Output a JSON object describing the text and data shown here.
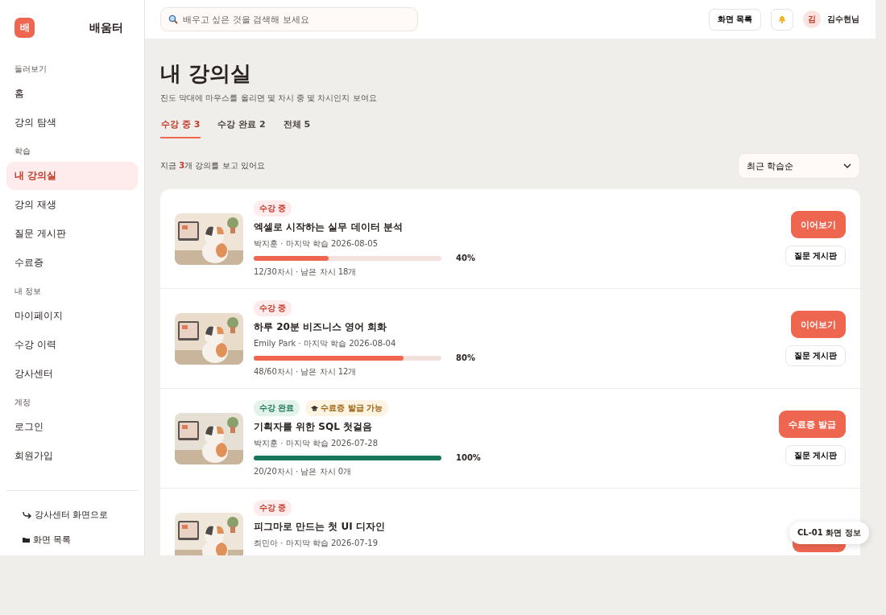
{
  "sidebar": {
    "logo": {
      "mark": "배",
      "name": "배움터"
    },
    "sections": [
      {
        "title": "둘러보기",
        "items": [
          {
            "label": "홈",
            "selected": false
          },
          {
            "label": "강의 탐색",
            "selected": false
          }
        ]
      },
      {
        "title": "학습",
        "items": [
          {
            "label": "내 강의실",
            "selected": true
          },
          {
            "label": "강의 재생",
            "selected": false
          },
          {
            "label": "질문 게시판",
            "selected": false
          },
          {
            "label": "수료증",
            "selected": false
          }
        ]
      },
      {
        "title": "내 정보",
        "items": [
          {
            "label": "마이페이지",
            "selected": false
          },
          {
            "label": "수강 이력",
            "selected": false
          },
          {
            "label": "강사센터",
            "selected": false
          }
        ]
      },
      {
        "title": "계정",
        "items": [
          {
            "label": "로그인",
            "selected": false
          },
          {
            "label": "회원가입",
            "selected": false
          }
        ]
      }
    ],
    "footer_links": [
      {
        "kind": "switch",
        "label": "강사센터 화면으로"
      },
      {
        "kind": "folder",
        "label": "화면 목록"
      }
    ]
  },
  "topbar": {
    "search": {
      "placeholder": "배우고 싶은 것을 검색해 보세요"
    },
    "screens_button": "화면 목록",
    "user": {
      "initial": "김",
      "name": "김수현님"
    }
  },
  "page": {
    "title": "내 강의실",
    "subtitle": "진도 막대에 마우스를 올리면 몇 차시 중 몇 차시인지 보여요",
    "tabs": [
      {
        "label": "수강 중 3",
        "selected": true
      },
      {
        "label": "수강 완료 2",
        "selected": false
      },
      {
        "label": "전체 5",
        "selected": false
      }
    ],
    "summary": "지금 **3**개 강의를 보고 있어요",
    "sort": {
      "value": "최근 학습순"
    },
    "courses": [
      {
        "badges": [
          {
            "kind": "progress",
            "label": "수강 중"
          }
        ],
        "title": "엑셀로 시작하는 실무 데이터 분석",
        "meta": "박지훈 · 마지막 학습 2026-08-05",
        "level": 0.4,
        "complete": false,
        "percent": "40%",
        "sessions": "12/30차시 · 남은 차시 18개",
        "primary": "이어보기",
        "secondary": "질문 게시판"
      },
      {
        "badges": [
          {
            "kind": "progress",
            "label": "수강 중"
          }
        ],
        "title": "하루 20분 비즈니스 영어 회화",
        "meta": "Emily Park · 마지막 학습 2026-08-04",
        "level": 0.8,
        "complete": false,
        "percent": "80%",
        "sessions": "48/60차시 · 남은 차시 12개",
        "primary": "이어보기",
        "secondary": "질문 게시판"
      },
      {
        "badges": [
          {
            "kind": "done",
            "label": "수강 완료"
          },
          {
            "kind": "certificate",
            "label": "수료증 발급 가능"
          }
        ],
        "title": "기획자를 위한 SQL 첫걸음",
        "meta": "박지훈 · 마지막 학습 2026-07-28",
        "level": 1,
        "complete": true,
        "percent": "100%",
        "sessions": "20/20차시 · 남은 차시 0개",
        "primary": "수료증 발급",
        "secondary": "질문 게시판"
      },
      {
        "badges": [
          {
            "kind": "progress",
            "label": "수강 중"
          }
        ],
        "title": "피그마로 만드는 첫 UI 디자인",
        "meta": "최민아 · 마지막 학습 2026-07-19"
      }
    ]
  },
  "info_chip": "CL-01 화면 정보"
}
